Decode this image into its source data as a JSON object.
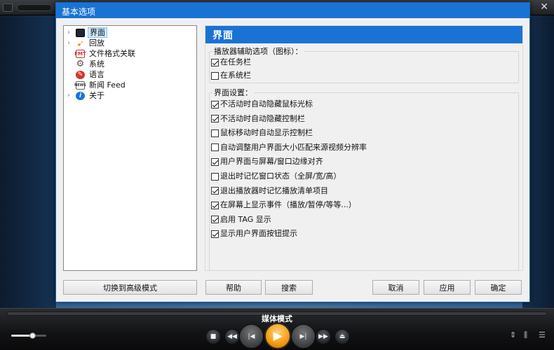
{
  "player": {
    "mode_label": "媒体模式",
    "volume_level": 0.6
  },
  "dialog": {
    "title": "基本选项",
    "tree": [
      {
        "label": "界面",
        "icon": "monitor-icon",
        "expand": "›",
        "glyph": "",
        "selected": true
      },
      {
        "label": "回放",
        "icon": "replay-icon",
        "expand": "›",
        "glyph": "➹"
      },
      {
        "label": "文件格式关联",
        "icon": "file-format-icon",
        "expand": "",
        "glyph": "FMT"
      },
      {
        "label": "系统",
        "icon": "gear-icon",
        "expand": "",
        "glyph": "⚙"
      },
      {
        "label": "语言",
        "icon": "language-icon",
        "expand": "",
        "glyph": "✎"
      },
      {
        "label": "新闻 Feed",
        "icon": "news-icon",
        "expand": "",
        "glyph": "NEWS"
      },
      {
        "label": "关于",
        "icon": "info-icon",
        "expand": "›",
        "glyph": "i"
      }
    ],
    "section_title": "界面",
    "group1": {
      "title": "播放器辅助选项（图标）：",
      "options": [
        {
          "label": "在任务栏",
          "checked": true
        },
        {
          "label": "在系统栏",
          "checked": false
        }
      ]
    },
    "group2": {
      "title": "界面设置：",
      "options": [
        {
          "label": "不活动时自动隐藏鼠标光标",
          "checked": true
        },
        {
          "label": "不活动时自动隐藏控制栏",
          "checked": true
        },
        {
          "label": "鼠标移动时自动显示控制栏",
          "checked": false
        },
        {
          "label": "自动调整用户界面大小匹配来源视频分辨率",
          "checked": false
        },
        {
          "label": "用户界面与屏幕/窗口边缘对齐",
          "checked": true
        },
        {
          "label": "退出时记忆窗口状态（全屏/宽/高）",
          "checked": false
        },
        {
          "label": "退出播放器时记忆播放清单项目",
          "checked": true
        },
        {
          "label": "在屏幕上显示事件（播放/暂停/等等...）",
          "checked": true
        },
        {
          "label": "启用 TAG 显示",
          "checked": true
        },
        {
          "label": "显示用户界面按钮提示",
          "checked": true
        }
      ]
    },
    "buttons": {
      "advanced": "切换到高级模式",
      "help": "帮助",
      "search": "搜索",
      "cancel": "取消",
      "apply": "应用",
      "ok": "确定"
    }
  }
}
